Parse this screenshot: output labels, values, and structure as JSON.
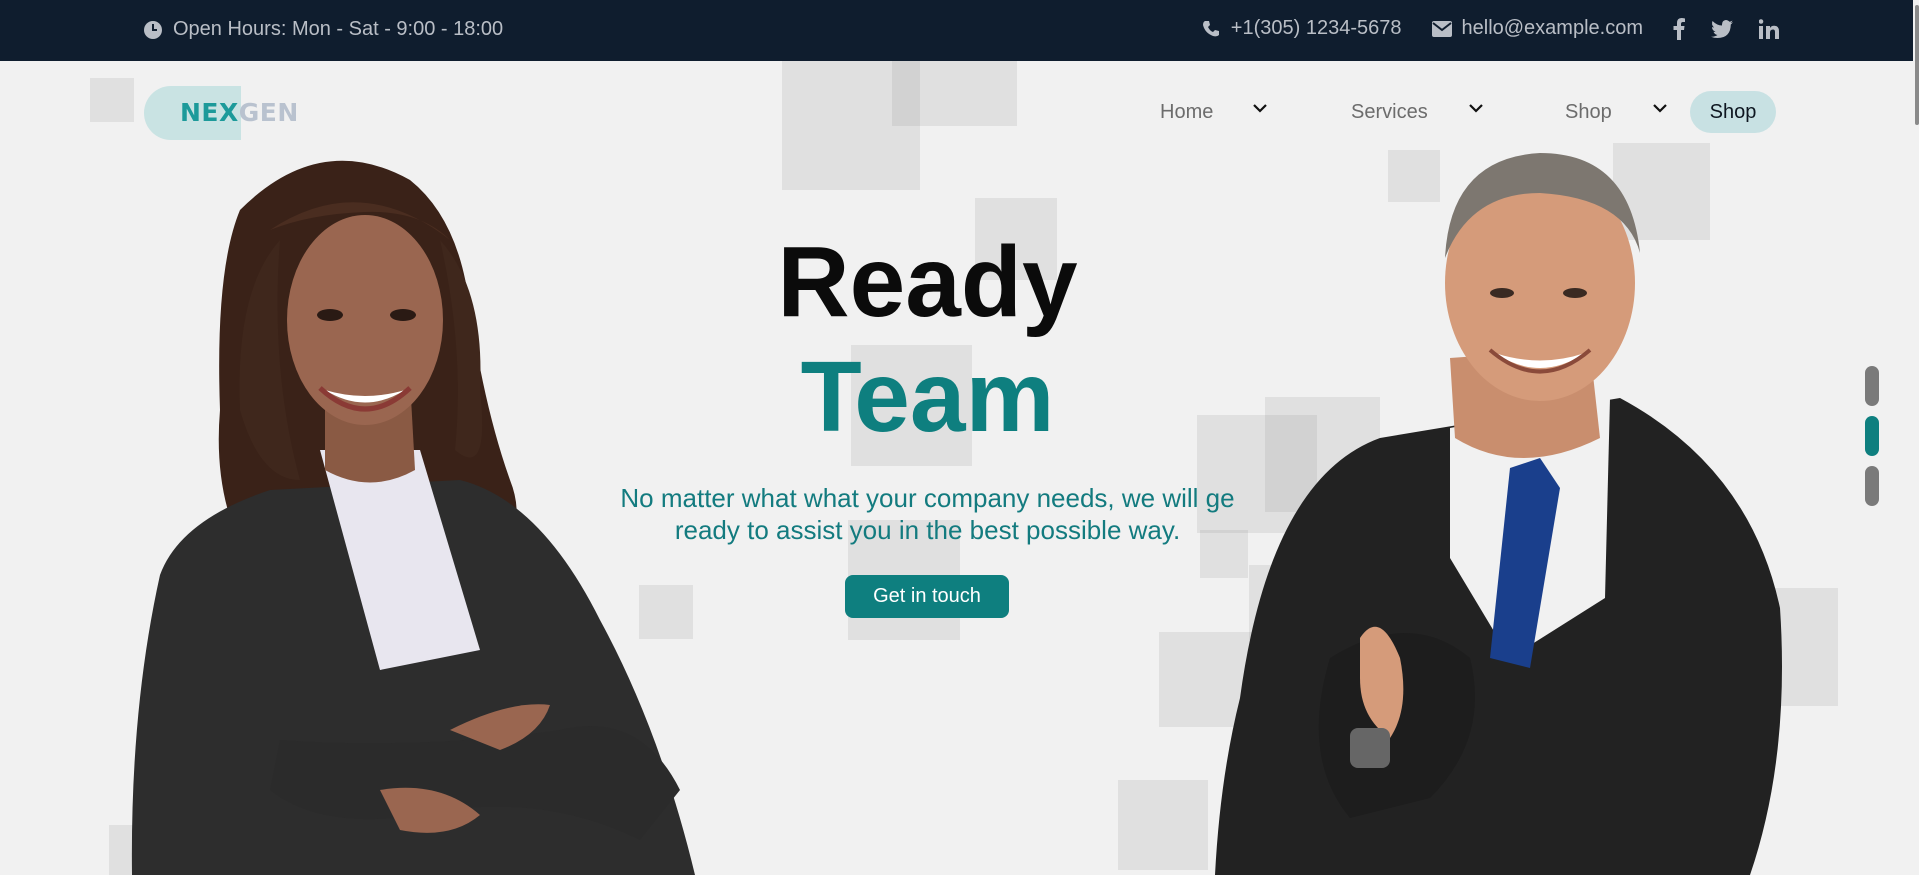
{
  "topbar": {
    "hours": "Open Hours: Mon - Sat - 9:00 - 18:00",
    "phone": "+1(305) 1234-5678",
    "email": "hello@example.com",
    "social": [
      "facebook-icon",
      "twitter-icon",
      "linkedin-icon"
    ]
  },
  "logo": {
    "part1": "NEX",
    "part2": "GEN"
  },
  "nav": {
    "items": [
      {
        "label": "Home"
      },
      {
        "label": "Services"
      },
      {
        "label": "Shop"
      }
    ],
    "cta": "Shop"
  },
  "hero": {
    "line1": "Ready",
    "line2": "Team",
    "subtitle": "No matter what what your company needs, we will ge ready to assist you in the best possible way.",
    "button": "Get in touch"
  },
  "slider": {
    "count": 3,
    "active_index": 1
  },
  "colors": {
    "topbar_bg": "#0f1d2e",
    "accent": "#0e7f7f",
    "page_bg": "#f1f1f1"
  }
}
